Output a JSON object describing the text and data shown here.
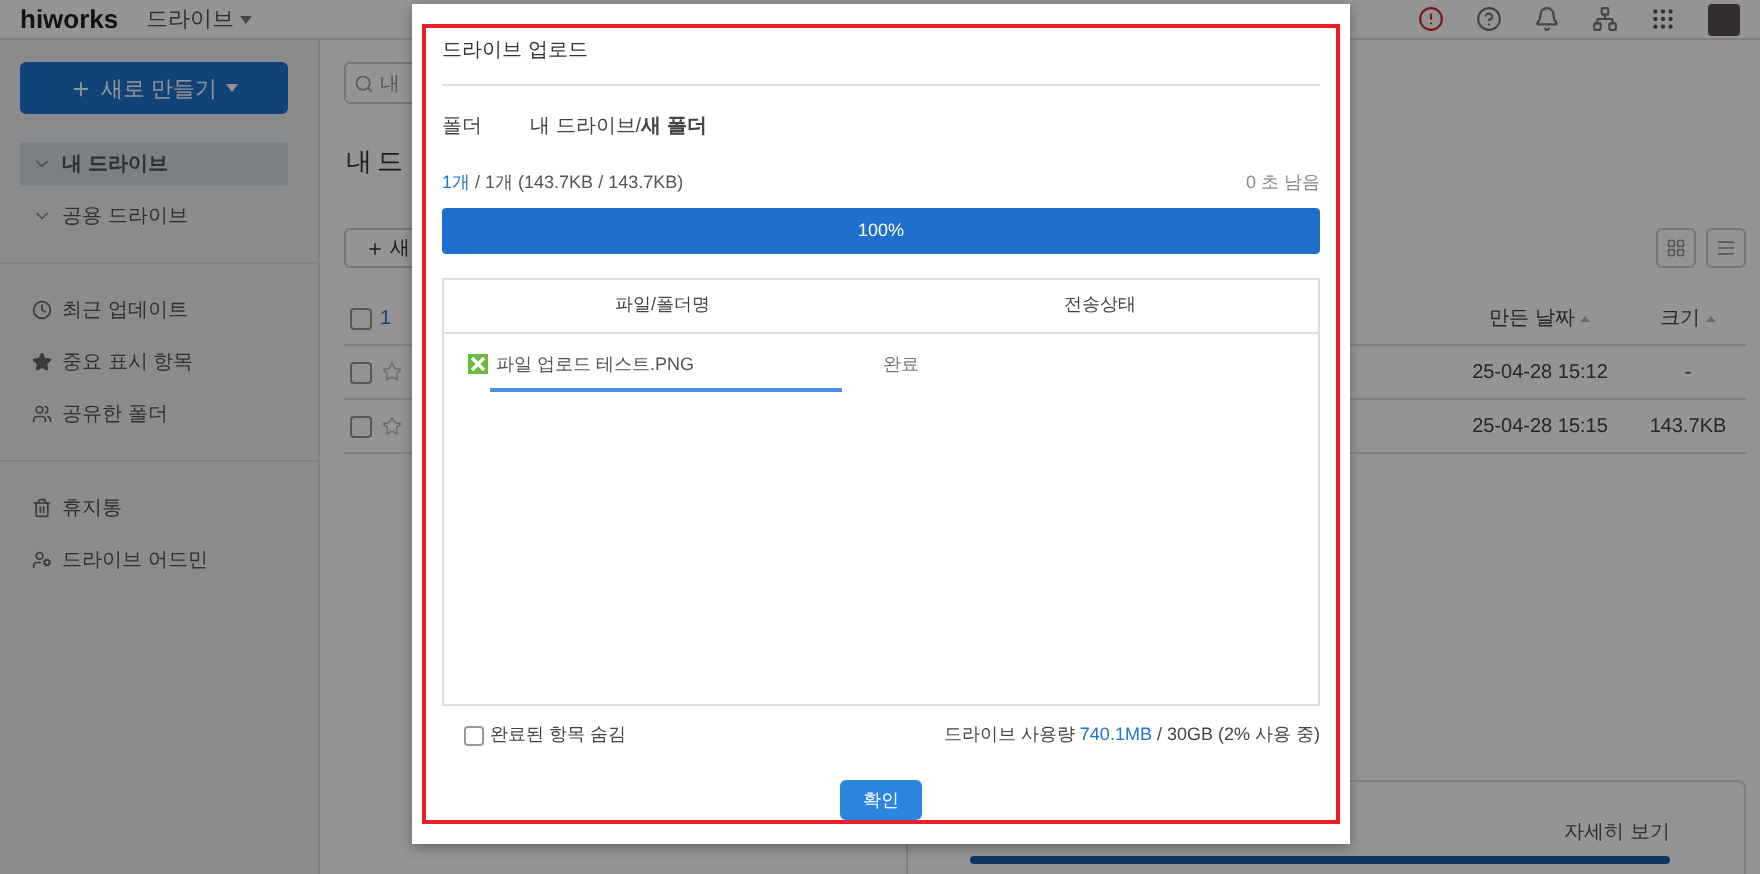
{
  "header": {
    "logo": "hiworks",
    "app_menu": "드라이브"
  },
  "sidebar": {
    "new_button": "새로 만들기",
    "drives": [
      {
        "label": "내 드라이브",
        "selected": true
      },
      {
        "label": "공용 드라이브",
        "selected": false
      }
    ],
    "views": [
      "최근 업데이트",
      "중요 표시 항목",
      "공유한 폴더"
    ],
    "tools": [
      "휴지통",
      "드라이브 어드민"
    ]
  },
  "main": {
    "search_placeholder": "내",
    "title": "내 드",
    "new_button": "새",
    "select_all": {
      "checked": false
    },
    "selected_count": "1",
    "columns": [
      "만든 날짜",
      "크기"
    ],
    "rows": [
      {
        "checked": false,
        "starred": false,
        "created": "25-04-28 15:12",
        "size": "-"
      },
      {
        "checked": false,
        "starred": false,
        "created": "25-04-28 15:15",
        "size": "143.7KB"
      }
    ],
    "details_link": "자세히 보기"
  },
  "dialog": {
    "title": "드라이브 업로드",
    "folder_label": "폴더",
    "folder_path": "내 드라이브/**새 폴더**",
    "progress": {
      "done": "1개",
      "rest": "/ 1개 (143.7KB / 143.7KB)",
      "remaining": "0 초 남음",
      "level": 1,
      "label": "100%"
    },
    "columns": [
      "파일/폴더명",
      "전송상태"
    ],
    "files": [
      {
        "name": "파일 업로드 테스트.PNG",
        "status": "완료",
        "level": 1
      }
    ],
    "hide_completed": {
      "label": "완료된 항목 숨김",
      "checked": false
    },
    "usage": {
      "label": "드라이브 사용량",
      "used": "740.1MB",
      "total": "/ 30GB (2% 사용 중)"
    },
    "confirm_button": "확인"
  }
}
